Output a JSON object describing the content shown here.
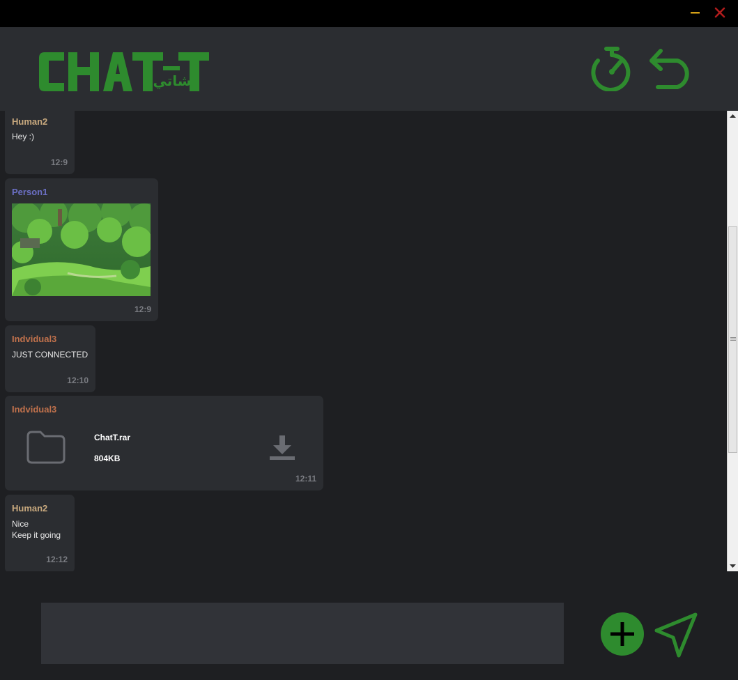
{
  "app": {
    "logo_text": "CHAT-T",
    "logo_arabic": "شاتي",
    "accent_color": "#2e8b2e"
  },
  "titlebar": {
    "minimize_icon": "minimize-icon",
    "close_icon": "close-icon",
    "minimize_color": "#d4a017",
    "close_color": "#b01c1c"
  },
  "header": {
    "left_icon": "stopwatch-icon",
    "right_icon": "return-arrow-icon"
  },
  "messages": [
    {
      "sender": "Human2",
      "sender_color": "#c8a97e",
      "lines": "Hey :)",
      "time": "12:9"
    },
    {
      "sender": "Person1",
      "sender_color": "#6b6fc4",
      "image": "forest-landscape-image",
      "time": "12:9"
    },
    {
      "sender": "Indvidual3",
      "sender_color": "#c0714c",
      "lines": "JUST CONNECTED",
      "time": "12:10"
    },
    {
      "sender": "Indvidual3",
      "sender_color": "#c0714c",
      "file_name": "ChatT.rar",
      "file_size": "804KB",
      "file_icon": "folder-icon",
      "action_icon": "download-icon",
      "time": "12:11"
    },
    {
      "sender": "Human2",
      "sender_color": "#c8a97e",
      "lines": "Nice\nKeep it going",
      "time": "12:12"
    }
  ],
  "composer": {
    "value": "",
    "add_icon": "plus-icon",
    "send_icon": "send-icon"
  }
}
